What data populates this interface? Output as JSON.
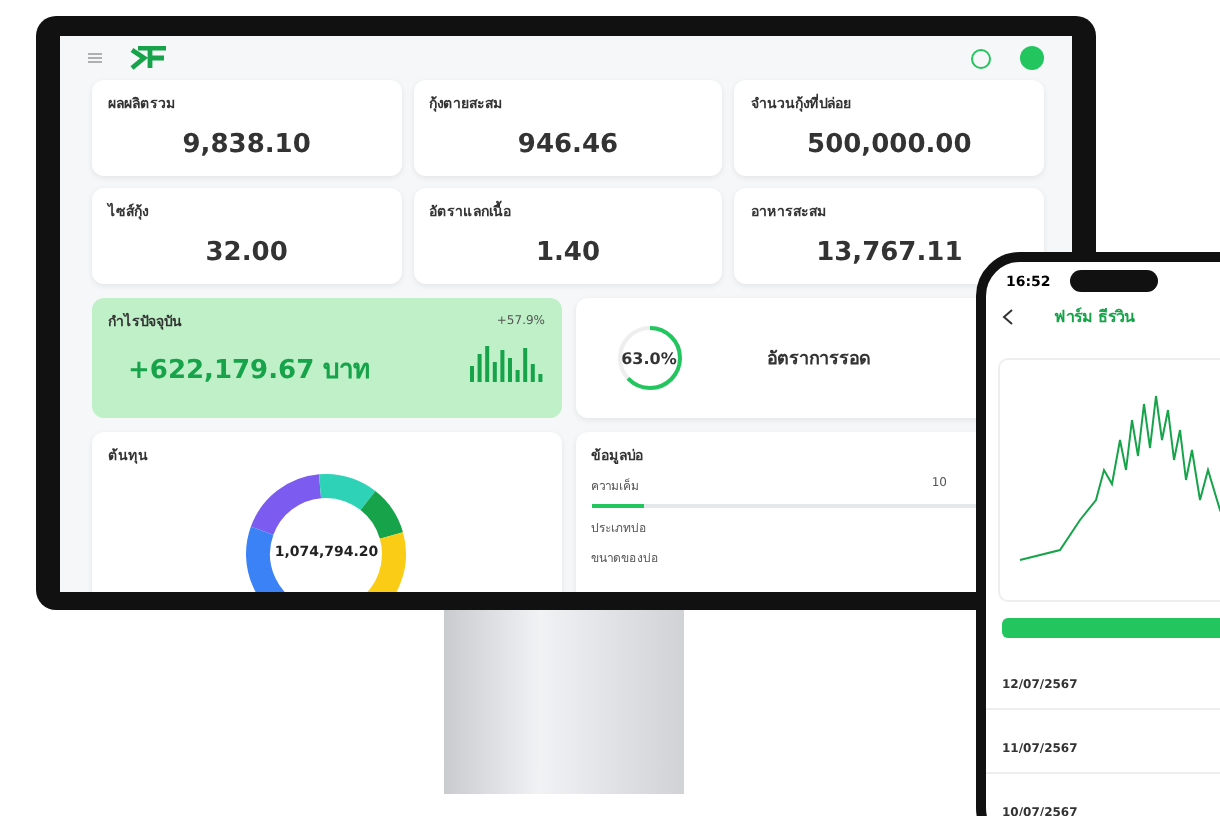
{
  "stats": [
    {
      "label": "ผลผลิตรวม",
      "value": "9,838.10"
    },
    {
      "label": "กุ้งตายสะสม",
      "value": "946.46"
    },
    {
      "label": "จำนวนกุ้งที่ปล่อย",
      "value": "500,000.00"
    },
    {
      "label": "ไซส์กุ้ง",
      "value": "32.00"
    },
    {
      "label": "อัตราแลกเนื้อ",
      "value": "1.40"
    },
    {
      "label": "อาหารสะสม",
      "value": "13,767.11"
    }
  ],
  "profit": {
    "label": "กำไรปัจจุบัน",
    "change": "+57.9%",
    "value": "+622,179.67 บาท"
  },
  "survival": {
    "reading": "63.0%",
    "level": 0.63,
    "label": "อัตราการรอด"
  },
  "cost": {
    "label": "ต้นทุน",
    "total": "1,074,794.20"
  },
  "pond": {
    "title": "ข้อมูลบ่อ",
    "rows": [
      {
        "label": "ความเค็ม",
        "value": "10",
        "level": 0.12
      },
      {
        "label": "ประเภทบ่อ"
      },
      {
        "label": "ขนาดของบ่อ"
      }
    ]
  },
  "phone": {
    "time": "16:52",
    "title": "ฟาร์ม ธีรวิน",
    "entries": [
      {
        "date": "12/07/2567"
      },
      {
        "date": "11/07/2567"
      },
      {
        "date": "10/07/2567"
      }
    ]
  }
}
